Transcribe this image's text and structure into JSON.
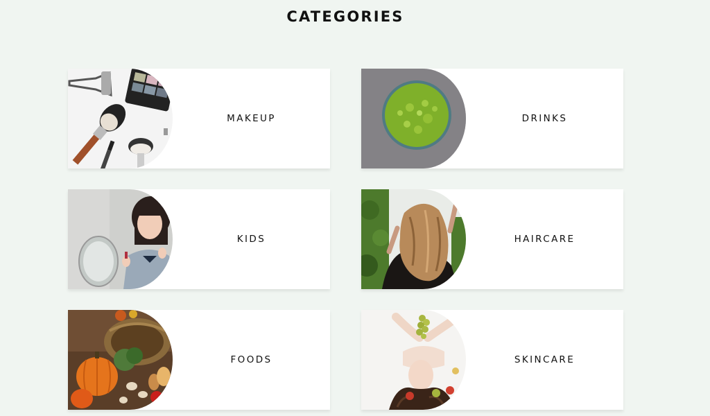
{
  "section": {
    "title": "CATEGORIES"
  },
  "categories": [
    {
      "label": "MAKEUP",
      "image": "makeup-tools-image"
    },
    {
      "label": "DRINKS",
      "image": "green-smoothie-image"
    },
    {
      "label": "KIDS",
      "image": "girl-with-lipstick-image"
    },
    {
      "label": "HAIRCARE",
      "image": "wavy-hair-image"
    },
    {
      "label": "FOODS",
      "image": "vegetable-basket-image"
    },
    {
      "label": "SKINCARE",
      "image": "woman-lying-with-grapes-image"
    }
  ],
  "colors": {
    "background": "#f0f5f1",
    "card": "#ffffff",
    "text": "#111111"
  }
}
